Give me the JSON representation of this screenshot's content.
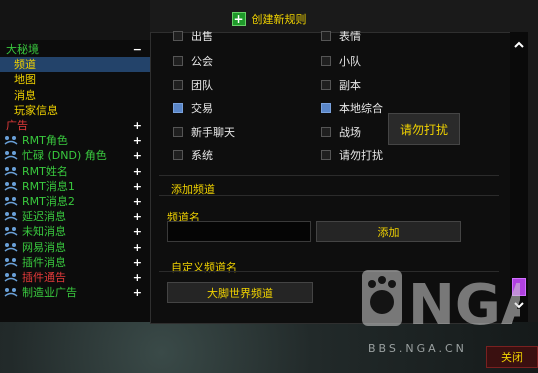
{
  "header": {
    "create_label": "创建新规则"
  },
  "sidebar": {
    "items": [
      {
        "label": "大秘境",
        "color": "#39c93e",
        "indent": 0,
        "toggle": "−",
        "icon": false,
        "selected": false
      },
      {
        "label": "频道",
        "color": "#f0d200",
        "indent": 1,
        "toggle": "",
        "icon": false,
        "selected": true
      },
      {
        "label": "地图",
        "color": "#f0d200",
        "indent": 1,
        "toggle": "",
        "icon": false,
        "selected": false
      },
      {
        "label": "消息",
        "color": "#f0d200",
        "indent": 1,
        "toggle": "",
        "icon": false,
        "selected": false
      },
      {
        "label": "玩家信息",
        "color": "#f0d200",
        "indent": 1,
        "toggle": "",
        "icon": false,
        "selected": false
      },
      {
        "label": "广告",
        "color": "#e33a3a",
        "indent": 0,
        "toggle": "+",
        "icon": false,
        "selected": false
      },
      {
        "label": "RMT角色",
        "color": "#39c93e",
        "indent": 2,
        "toggle": "+",
        "icon": true,
        "selected": false
      },
      {
        "label": "忙碌 (DND) 角色",
        "color": "#39c93e",
        "indent": 2,
        "toggle": "+",
        "icon": true,
        "selected": false
      },
      {
        "label": "RMT姓名",
        "color": "#39c93e",
        "indent": 2,
        "toggle": "+",
        "icon": true,
        "selected": false
      },
      {
        "label": "RMT消息1",
        "color": "#39c93e",
        "indent": 2,
        "toggle": "+",
        "icon": true,
        "selected": false
      },
      {
        "label": "RMT消息2",
        "color": "#39c93e",
        "indent": 2,
        "toggle": "+",
        "icon": true,
        "selected": false
      },
      {
        "label": "延迟消息",
        "color": "#39c93e",
        "indent": 2,
        "toggle": "+",
        "icon": true,
        "selected": false
      },
      {
        "label": "未知消息",
        "color": "#39c93e",
        "indent": 2,
        "toggle": "+",
        "icon": true,
        "selected": false
      },
      {
        "label": "网易消息",
        "color": "#39c93e",
        "indent": 2,
        "toggle": "+",
        "icon": true,
        "selected": false
      },
      {
        "label": "插件消息",
        "color": "#39c93e",
        "indent": 2,
        "toggle": "+",
        "icon": true,
        "selected": false
      },
      {
        "label": "插件通告",
        "color": "#e33a3a",
        "indent": 2,
        "toggle": "+",
        "icon": true,
        "selected": false
      },
      {
        "label": "制造业广告",
        "color": "#39c93e",
        "indent": 2,
        "toggle": "+",
        "icon": true,
        "selected": false
      }
    ]
  },
  "channels": {
    "top_partial": [
      "出售",
      "表情"
    ],
    "left": [
      {
        "label": "公会",
        "checked": false
      },
      {
        "label": "团队",
        "checked": false
      },
      {
        "label": "交易",
        "checked": true
      },
      {
        "label": "新手聊天",
        "checked": false
      },
      {
        "label": "系统",
        "checked": false
      }
    ],
    "right": [
      {
        "label": "小队",
        "checked": false
      },
      {
        "label": "副本",
        "checked": false
      },
      {
        "label": "本地综合",
        "checked": true
      },
      {
        "label": "战场",
        "checked": false
      },
      {
        "label": "请勿打扰",
        "checked": false
      }
    ],
    "dnd_button": "请勿打扰"
  },
  "add_channel": {
    "title": "添加频道",
    "name_label": "频道名",
    "name_value": "",
    "add_button": "添加"
  },
  "custom_channel": {
    "title": "自定义频道名",
    "button": "大脚世界频道"
  },
  "watermark": {
    "text": "NGA",
    "url": "BBS.NGA.CN"
  },
  "footer": {
    "close_label": "关闭"
  }
}
